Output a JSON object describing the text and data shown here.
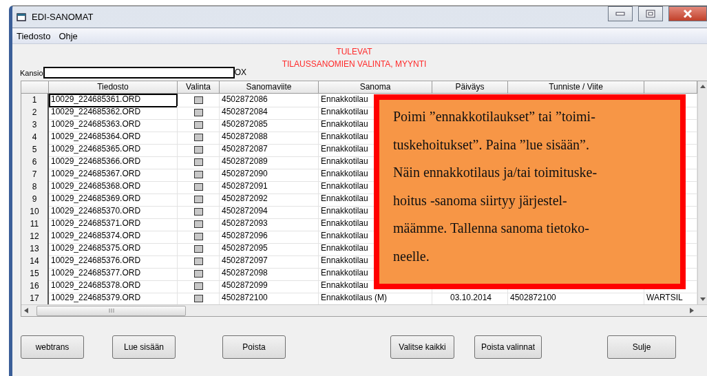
{
  "window": {
    "title": "EDI-SANOMAT"
  },
  "menu": [
    "Tiedosto",
    "Ohje"
  ],
  "heading": [
    "TULEVAT",
    "TILAUSSANOMIEN VALINTA, MYYNTI"
  ],
  "folder": {
    "label": "Kansio",
    "suffix": "OX"
  },
  "table": {
    "columns": [
      "Tiedosto",
      "Valinta",
      "Sanomaviite",
      "Sanoma",
      "Päiväys",
      "Tunniste / Viite"
    ],
    "rows": [
      {
        "number": "1",
        "file": "10029_224685361.ORD",
        "selected": true,
        "checked": false,
        "reference": "4502872086",
        "message": "Ennakkotilau"
      },
      {
        "number": "2",
        "file": "10029_224685362.ORD",
        "selected": false,
        "checked": false,
        "reference": "4502872084",
        "message": "Ennakkotilau"
      },
      {
        "number": "3",
        "file": "10029_224685363.ORD",
        "selected": false,
        "checked": false,
        "reference": "4502872085",
        "message": "Ennakkotilau"
      },
      {
        "number": "4",
        "file": "10029_224685364.ORD",
        "selected": false,
        "checked": false,
        "reference": "4502872088",
        "message": "Ennakkotilau"
      },
      {
        "number": "5",
        "file": "10029_224685365.ORD",
        "selected": false,
        "checked": false,
        "reference": "4502872087",
        "message": "Ennakkotilau"
      },
      {
        "number": "6",
        "file": "10029_224685366.ORD",
        "selected": false,
        "checked": false,
        "reference": "4502872089",
        "message": "Ennakkotilau"
      },
      {
        "number": "7",
        "file": "10029_224685367.ORD",
        "selected": false,
        "checked": false,
        "reference": "4502872090",
        "message": "Ennakkotilau"
      },
      {
        "number": "8",
        "file": "10029_224685368.ORD",
        "selected": false,
        "checked": false,
        "reference": "4502872091",
        "message": "Ennakkotilau"
      },
      {
        "number": "9",
        "file": "10029_224685369.ORD",
        "selected": false,
        "checked": false,
        "reference": "4502872092",
        "message": "Ennakkotilau"
      },
      {
        "number": "10",
        "file": "10029_224685370.ORD",
        "selected": false,
        "checked": false,
        "reference": "4502872094",
        "message": "Ennakkotilau"
      },
      {
        "number": "11",
        "file": "10029_224685371.ORD",
        "selected": false,
        "checked": false,
        "reference": "4502872093",
        "message": "Ennakkotilau"
      },
      {
        "number": "12",
        "file": "10029_224685374.ORD",
        "selected": false,
        "checked": false,
        "reference": "4502872096",
        "message": "Ennakkotilau"
      },
      {
        "number": "13",
        "file": "10029_224685375.ORD",
        "selected": false,
        "checked": false,
        "reference": "4502872095",
        "message": "Ennakkotilau"
      },
      {
        "number": "14",
        "file": "10029_224685376.ORD",
        "selected": false,
        "checked": false,
        "reference": "4502872097",
        "message": "Ennakkotilau"
      },
      {
        "number": "15",
        "file": "10029_224685377.ORD",
        "selected": false,
        "checked": false,
        "reference": "4502872098",
        "message": "Ennakkotilau"
      },
      {
        "number": "16",
        "file": "10029_224685378.ORD",
        "selected": false,
        "checked": false,
        "reference": "4502872099",
        "message": "Ennakkotilau"
      },
      {
        "number": "17",
        "file": "10029_224685379.ORD",
        "selected": false,
        "checked": false,
        "reference": "4502872100",
        "message": "Ennakkotilaus (M)",
        "date": "03.10.2014",
        "identifier": "4502872100",
        "column_8": "WARTSIL"
      }
    ]
  },
  "callout": [
    "Poimi ”ennakkotilaukset” tai ”toimi-",
    "tuskehoitukset”. Paina ”lue sisään”.",
    "Näin ennakkotilaus ja/tai toimituske-",
    "hoitus -sanoma siirtyy järjestel-",
    "määmme. Tallenna sanoma tietoko-",
    "neelle."
  ],
  "buttons": [
    "webtrans",
    "Lue sisään",
    "Poista",
    "Valitse kaikki",
    "Poista valinnat",
    "Sulje"
  ]
}
